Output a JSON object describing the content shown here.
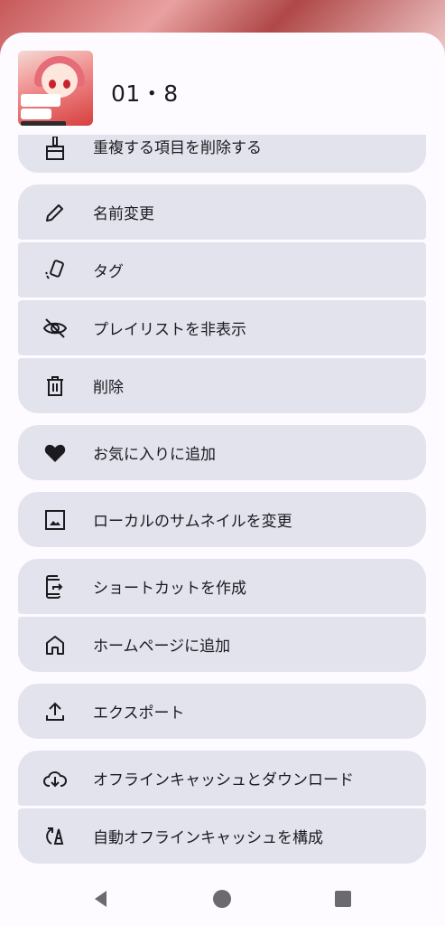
{
  "playlist": {
    "title": "01・8"
  },
  "menu": {
    "groups": [
      {
        "items": [
          {
            "icon": "broom-icon",
            "label": "重複する項目を削除する",
            "name": "remove-duplicates-item"
          }
        ]
      },
      {
        "items": [
          {
            "icon": "pencil-icon",
            "label": "名前変更",
            "name": "rename-item"
          },
          {
            "icon": "tag-icon",
            "label": "タグ",
            "name": "tag-item"
          },
          {
            "icon": "eye-off-icon",
            "label": "プレイリストを非表示",
            "name": "hide-playlist-item"
          },
          {
            "icon": "trash-icon",
            "label": "削除",
            "name": "delete-item"
          }
        ]
      },
      {
        "items": [
          {
            "icon": "heart-icon",
            "label": "お気に入りに追加",
            "name": "add-favorite-item"
          }
        ]
      },
      {
        "items": [
          {
            "icon": "image-icon",
            "label": "ローカルのサムネイルを変更",
            "name": "change-thumbnail-item"
          }
        ]
      },
      {
        "items": [
          {
            "icon": "shortcut-icon",
            "label": "ショートカットを作成",
            "name": "create-shortcut-item"
          },
          {
            "icon": "home-icon",
            "label": "ホームページに追加",
            "name": "add-homepage-item"
          }
        ]
      },
      {
        "items": [
          {
            "icon": "upload-icon",
            "label": "エクスポート",
            "name": "export-item"
          }
        ]
      },
      {
        "items": [
          {
            "icon": "cloud-download-icon",
            "label": "オフラインキャッシュとダウンロード",
            "name": "offline-download-item"
          },
          {
            "icon": "auto-cache-icon",
            "label": "自動オフラインキャッシュを構成",
            "name": "auto-offline-cache-item"
          }
        ]
      }
    ]
  },
  "colors": {
    "item_bg": "#e3e3ee",
    "sheet_bg": "#fdfbff",
    "icon": "#1b1b1f"
  }
}
